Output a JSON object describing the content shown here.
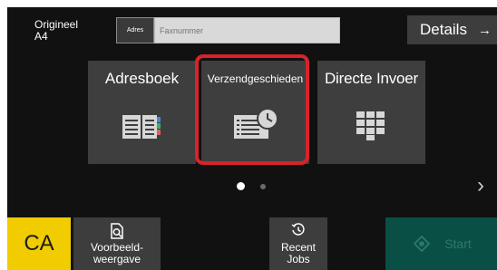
{
  "header": {
    "original_label_line1": "Origineel",
    "original_label_line2": "A4",
    "address_button": "Adres",
    "fax_placeholder": "Faxnummer",
    "details_label": "Details",
    "details_arrow": "→"
  },
  "tiles": {
    "addressbook": {
      "label": "Adresboek",
      "icon": "book-icon"
    },
    "send_history": {
      "label": "Verzendgeschieden",
      "icon": "history-list-clock-icon",
      "highlighted": true
    },
    "direct_input": {
      "label": "Directe Invoer",
      "icon": "keypad-icon"
    }
  },
  "pager": {
    "pages": 2,
    "current": 1,
    "next_arrow": "›"
  },
  "bottom": {
    "ca_label": "CA",
    "preview_line1": "Voorbeeld-",
    "preview_line2": "weergave",
    "recent_line1": "Recent",
    "recent_line2": "Jobs",
    "start_label": "Start"
  },
  "colors": {
    "background": "#111111",
    "tile": "#3e3e3e",
    "highlight": "#d8232a",
    "ca": "#f0cc00",
    "start": "#0a4f46"
  }
}
